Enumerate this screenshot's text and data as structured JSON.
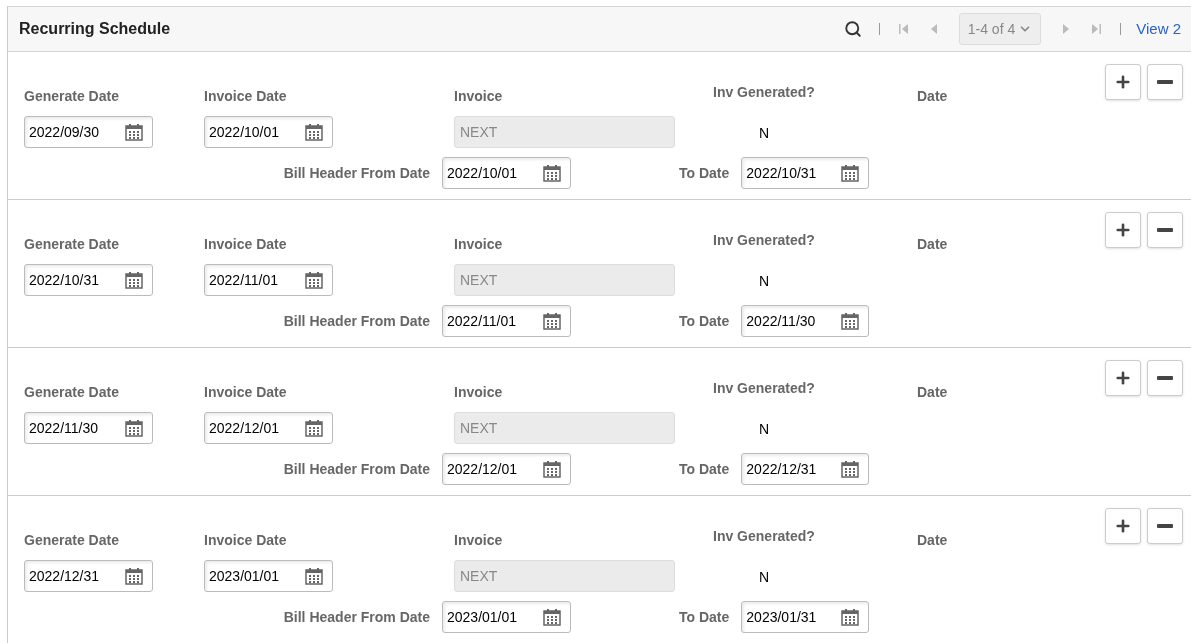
{
  "header": {
    "title": "Recurring Schedule",
    "range": "1-4 of 4",
    "view_link": "View 2",
    "nav_buttons": [
      {
        "kind": "first",
        "disabled": true
      },
      {
        "kind": "prev",
        "disabled": true
      },
      {
        "kind": "next",
        "disabled": true
      },
      {
        "kind": "last",
        "disabled": true
      }
    ]
  },
  "rows": [
    {
      "generate_label": "Generate Date",
      "generate_date": "2022/09/30",
      "invoice_date_label": "Invoice Date",
      "invoice_date": "2022/10/01",
      "invoice_label": "Invoice",
      "invoice": "NEXT",
      "inv_generated_label": "Inv Generated?",
      "inv_generated": "N",
      "date_label": "Date",
      "from_label": "Bill Header From Date",
      "from_date": "2022/10/01",
      "to_label": "To Date",
      "to_date": "2022/10/31"
    },
    {
      "generate_label": "Generate Date",
      "generate_date": "2022/10/31",
      "invoice_date_label": "Invoice Date",
      "invoice_date": "2022/11/01",
      "invoice_label": "Invoice",
      "invoice": "NEXT",
      "inv_generated_label": "Inv Generated?",
      "inv_generated": "N",
      "date_label": "Date",
      "from_label": "Bill Header From Date",
      "from_date": "2022/11/01",
      "to_label": "To Date",
      "to_date": "2022/11/30"
    },
    {
      "generate_label": "Generate Date",
      "generate_date": "2022/11/30",
      "invoice_date_label": "Invoice Date",
      "invoice_date": "2022/12/01",
      "invoice_label": "Invoice",
      "invoice": "NEXT",
      "inv_generated_label": "Inv Generated?",
      "inv_generated": "N",
      "date_label": "Date",
      "from_label": "Bill Header From Date",
      "from_date": "2022/12/01",
      "to_label": "To Date",
      "to_date": "2022/12/31"
    },
    {
      "generate_label": "Generate Date",
      "generate_date": "2022/12/31",
      "invoice_date_label": "Invoice Date",
      "invoice_date": "2023/01/01",
      "invoice_label": "Invoice",
      "invoice": "NEXT",
      "inv_generated_label": "Inv Generated?",
      "inv_generated": "N",
      "date_label": "Date",
      "from_label": "Bill Header From Date",
      "from_date": "2023/01/01",
      "to_label": "To Date",
      "to_date": "2023/01/31"
    }
  ]
}
